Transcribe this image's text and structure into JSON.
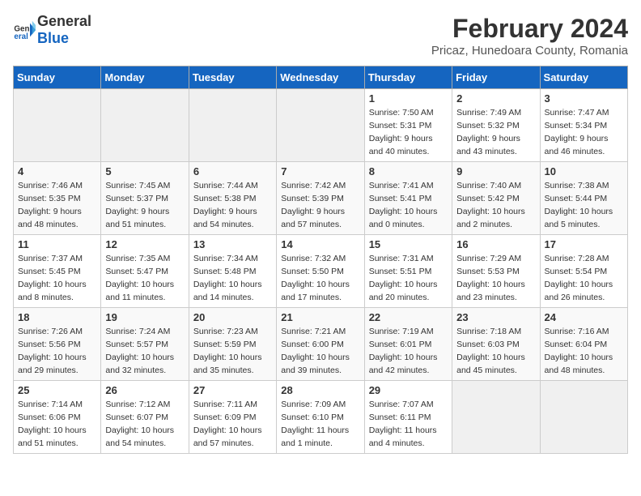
{
  "header": {
    "logo_general": "General",
    "logo_blue": "Blue",
    "main_title": "February 2024",
    "subtitle": "Pricaz, Hunedoara County, Romania"
  },
  "days_of_week": [
    "Sunday",
    "Monday",
    "Tuesday",
    "Wednesday",
    "Thursday",
    "Friday",
    "Saturday"
  ],
  "weeks": [
    [
      {
        "day": "",
        "info": ""
      },
      {
        "day": "",
        "info": ""
      },
      {
        "day": "",
        "info": ""
      },
      {
        "day": "",
        "info": ""
      },
      {
        "day": "1",
        "info": "Sunrise: 7:50 AM\nSunset: 5:31 PM\nDaylight: 9 hours\nand 40 minutes."
      },
      {
        "day": "2",
        "info": "Sunrise: 7:49 AM\nSunset: 5:32 PM\nDaylight: 9 hours\nand 43 minutes."
      },
      {
        "day": "3",
        "info": "Sunrise: 7:47 AM\nSunset: 5:34 PM\nDaylight: 9 hours\nand 46 minutes."
      }
    ],
    [
      {
        "day": "4",
        "info": "Sunrise: 7:46 AM\nSunset: 5:35 PM\nDaylight: 9 hours\nand 48 minutes."
      },
      {
        "day": "5",
        "info": "Sunrise: 7:45 AM\nSunset: 5:37 PM\nDaylight: 9 hours\nand 51 minutes."
      },
      {
        "day": "6",
        "info": "Sunrise: 7:44 AM\nSunset: 5:38 PM\nDaylight: 9 hours\nand 54 minutes."
      },
      {
        "day": "7",
        "info": "Sunrise: 7:42 AM\nSunset: 5:39 PM\nDaylight: 9 hours\nand 57 minutes."
      },
      {
        "day": "8",
        "info": "Sunrise: 7:41 AM\nSunset: 5:41 PM\nDaylight: 10 hours\nand 0 minutes."
      },
      {
        "day": "9",
        "info": "Sunrise: 7:40 AM\nSunset: 5:42 PM\nDaylight: 10 hours\nand 2 minutes."
      },
      {
        "day": "10",
        "info": "Sunrise: 7:38 AM\nSunset: 5:44 PM\nDaylight: 10 hours\nand 5 minutes."
      }
    ],
    [
      {
        "day": "11",
        "info": "Sunrise: 7:37 AM\nSunset: 5:45 PM\nDaylight: 10 hours\nand 8 minutes."
      },
      {
        "day": "12",
        "info": "Sunrise: 7:35 AM\nSunset: 5:47 PM\nDaylight: 10 hours\nand 11 minutes."
      },
      {
        "day": "13",
        "info": "Sunrise: 7:34 AM\nSunset: 5:48 PM\nDaylight: 10 hours\nand 14 minutes."
      },
      {
        "day": "14",
        "info": "Sunrise: 7:32 AM\nSunset: 5:50 PM\nDaylight: 10 hours\nand 17 minutes."
      },
      {
        "day": "15",
        "info": "Sunrise: 7:31 AM\nSunset: 5:51 PM\nDaylight: 10 hours\nand 20 minutes."
      },
      {
        "day": "16",
        "info": "Sunrise: 7:29 AM\nSunset: 5:53 PM\nDaylight: 10 hours\nand 23 minutes."
      },
      {
        "day": "17",
        "info": "Sunrise: 7:28 AM\nSunset: 5:54 PM\nDaylight: 10 hours\nand 26 minutes."
      }
    ],
    [
      {
        "day": "18",
        "info": "Sunrise: 7:26 AM\nSunset: 5:56 PM\nDaylight: 10 hours\nand 29 minutes."
      },
      {
        "day": "19",
        "info": "Sunrise: 7:24 AM\nSunset: 5:57 PM\nDaylight: 10 hours\nand 32 minutes."
      },
      {
        "day": "20",
        "info": "Sunrise: 7:23 AM\nSunset: 5:59 PM\nDaylight: 10 hours\nand 35 minutes."
      },
      {
        "day": "21",
        "info": "Sunrise: 7:21 AM\nSunset: 6:00 PM\nDaylight: 10 hours\nand 39 minutes."
      },
      {
        "day": "22",
        "info": "Sunrise: 7:19 AM\nSunset: 6:01 PM\nDaylight: 10 hours\nand 42 minutes."
      },
      {
        "day": "23",
        "info": "Sunrise: 7:18 AM\nSunset: 6:03 PM\nDaylight: 10 hours\nand 45 minutes."
      },
      {
        "day": "24",
        "info": "Sunrise: 7:16 AM\nSunset: 6:04 PM\nDaylight: 10 hours\nand 48 minutes."
      }
    ],
    [
      {
        "day": "25",
        "info": "Sunrise: 7:14 AM\nSunset: 6:06 PM\nDaylight: 10 hours\nand 51 minutes."
      },
      {
        "day": "26",
        "info": "Sunrise: 7:12 AM\nSunset: 6:07 PM\nDaylight: 10 hours\nand 54 minutes."
      },
      {
        "day": "27",
        "info": "Sunrise: 7:11 AM\nSunset: 6:09 PM\nDaylight: 10 hours\nand 57 minutes."
      },
      {
        "day": "28",
        "info": "Sunrise: 7:09 AM\nSunset: 6:10 PM\nDaylight: 11 hours\nand 1 minute."
      },
      {
        "day": "29",
        "info": "Sunrise: 7:07 AM\nSunset: 6:11 PM\nDaylight: 11 hours\nand 4 minutes."
      },
      {
        "day": "",
        "info": ""
      },
      {
        "day": "",
        "info": ""
      }
    ]
  ]
}
